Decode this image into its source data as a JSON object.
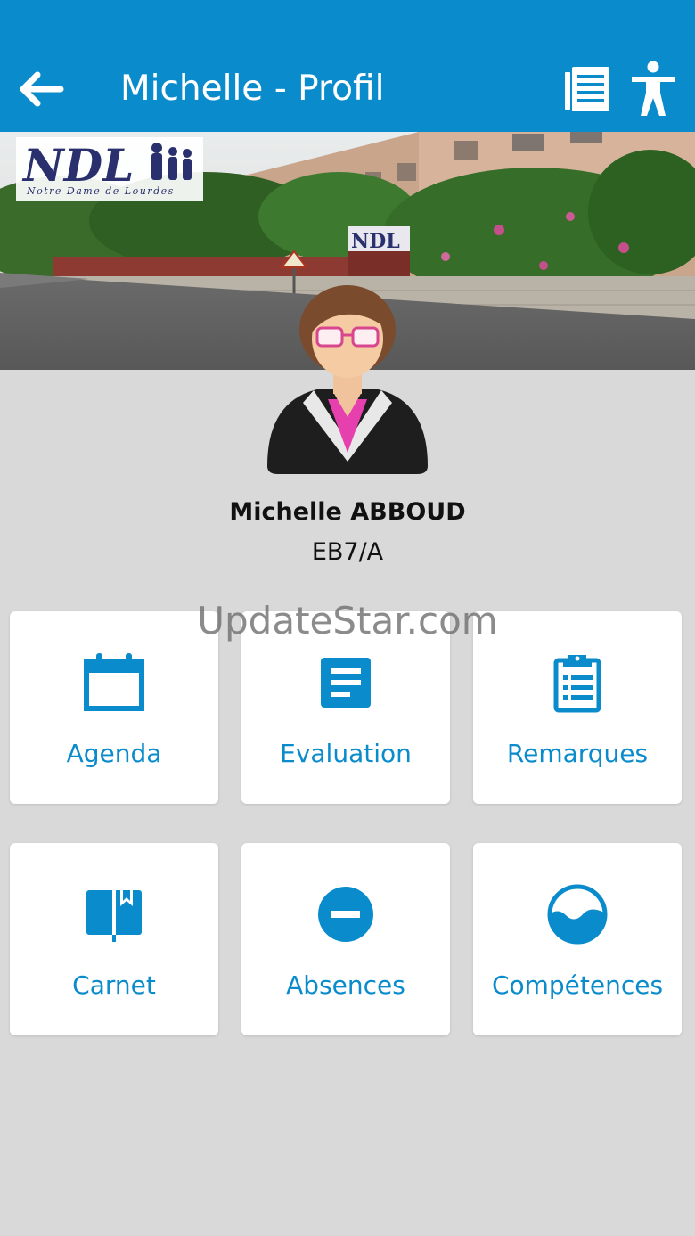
{
  "header": {
    "title": "Michelle - Profil",
    "back_icon": "arrow-left-icon",
    "news_icon": "newspaper-icon",
    "accessibility_icon": "accessibility-icon",
    "background": "#0a8bcc"
  },
  "banner": {
    "logo_text": "NDL",
    "logo_subtitle": "Notre Dame de Lourdes",
    "sign_text": "NDL"
  },
  "student": {
    "name": "Michelle ABBOUD",
    "class": "EB7/A"
  },
  "watermark": "UpdateStar.com",
  "tiles": [
    {
      "label": "Agenda",
      "icon": "calendar-icon"
    },
    {
      "label": "Evaluation",
      "icon": "document-icon"
    },
    {
      "label": "Remarques",
      "icon": "clipboard-icon"
    },
    {
      "label": "Carnet",
      "icon": "book-icon"
    },
    {
      "label": "Absences",
      "icon": "minus-circle-icon"
    },
    {
      "label": "Compétences",
      "icon": "wave-circle-icon"
    }
  ],
  "colors": {
    "accent": "#0a8bcc",
    "page_background": "#d9d9d9",
    "tile_background": "#ffffff"
  }
}
